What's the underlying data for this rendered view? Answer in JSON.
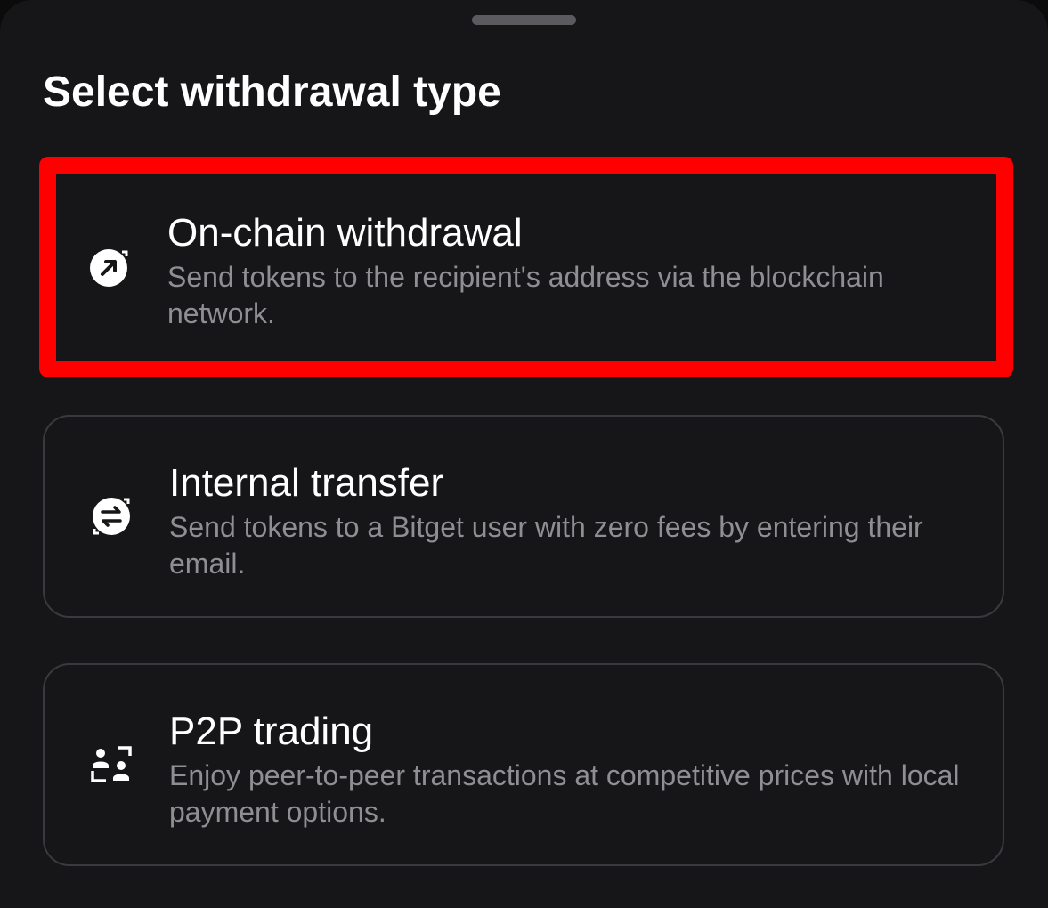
{
  "sheet": {
    "title": "Select withdrawal type"
  },
  "options": [
    {
      "icon": "arrow-up-right-circle-icon",
      "title": "On-chain withdrawal",
      "description": "Send tokens to the recipient's address via the blockchain network.",
      "highlighted": true
    },
    {
      "icon": "swap-arrows-circle-icon",
      "title": "Internal transfer",
      "description": "Send tokens to a Bitget user with zero fees by entering their email.",
      "highlighted": false
    },
    {
      "icon": "p2p-users-icon",
      "title": "P2P trading",
      "description": "Enjoy peer-to-peer transactions at competitive prices with local payment options.",
      "highlighted": false
    }
  ],
  "colors": {
    "highlight_border": "#ff0000",
    "background": "#161618",
    "text_primary": "#ffffff",
    "text_secondary": "#8e8e93"
  }
}
